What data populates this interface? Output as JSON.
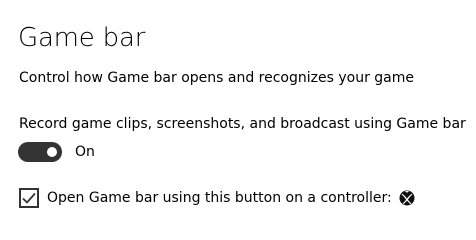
{
  "header": {
    "title": "Game bar"
  },
  "description": "Control how Game bar opens and recognizes your game",
  "record_setting": {
    "label": "Record game clips, screenshots, and broadcast using Game bar",
    "toggle_on": true,
    "toggle_state_label": "On"
  },
  "controller_setting": {
    "checked": true,
    "label": "Open Game bar using this button on a controller:",
    "icon": "xbox-logo-icon"
  },
  "colors": {
    "toggle_on": "#333333",
    "text": "#000000",
    "background": "#ffffff"
  }
}
